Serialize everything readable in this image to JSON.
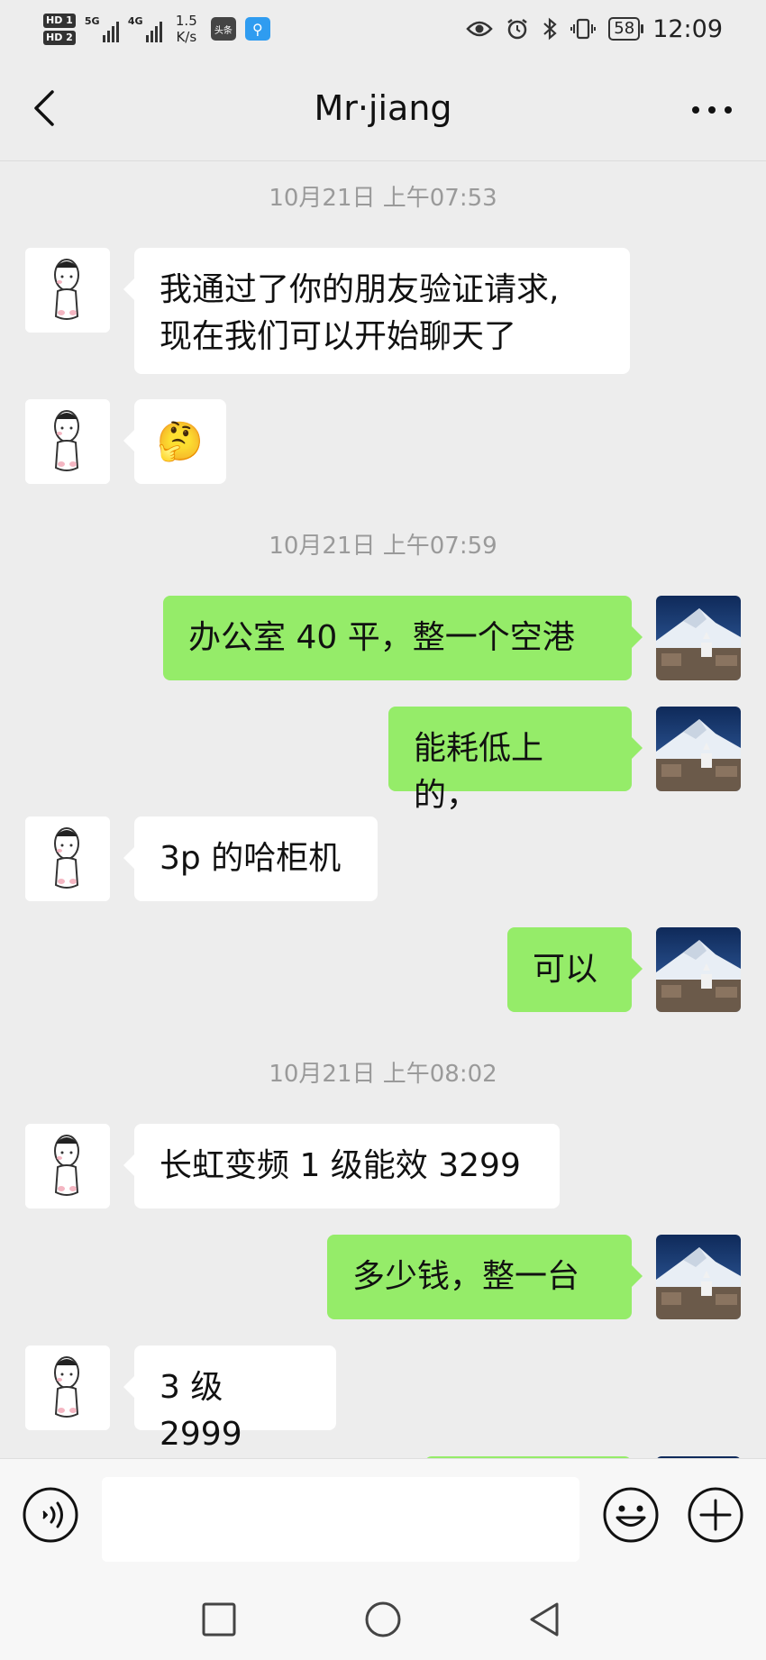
{
  "status_bar": {
    "hd1": "HD 1",
    "hd2": "HD 2",
    "net1": "5G",
    "net2": "4G",
    "speed_value": "1.5",
    "speed_unit": "K/s",
    "news_app": "头条",
    "battery": "58",
    "time": "12:09"
  },
  "header": {
    "title": "Mr·jiang"
  },
  "messages": [
    {
      "type": "time",
      "text": "10月21日 上午07:53"
    },
    {
      "type": "text",
      "from": "other",
      "lines": [
        "我通过了你的朋友验证请求,",
        "现在我们可以开始聊天了"
      ]
    },
    {
      "type": "emoji",
      "from": "other",
      "text": "🤔"
    },
    {
      "type": "time",
      "text": "10月21日 上午07:59"
    },
    {
      "type": "text",
      "from": "me",
      "text": "办公室 40 平，整一个空港"
    },
    {
      "type": "text",
      "from": "me",
      "text": "能耗低上的，"
    },
    {
      "type": "text",
      "from": "other",
      "text": "3p 的哈柜机"
    },
    {
      "type": "text",
      "from": "me",
      "text": "可以"
    },
    {
      "type": "time",
      "text": "10月21日 上午08:02"
    },
    {
      "type": "text",
      "from": "other",
      "text": "长虹变频 1 级能效 3299"
    },
    {
      "type": "text",
      "from": "me",
      "text": "多少钱，整一台"
    },
    {
      "type": "text",
      "from": "other",
      "text": "3 级 2999"
    }
  ],
  "input": {
    "value": ""
  },
  "colors": {
    "outgoing_bubble": "#95ec69",
    "incoming_bubble": "#ffffff",
    "background": "#ededed"
  }
}
